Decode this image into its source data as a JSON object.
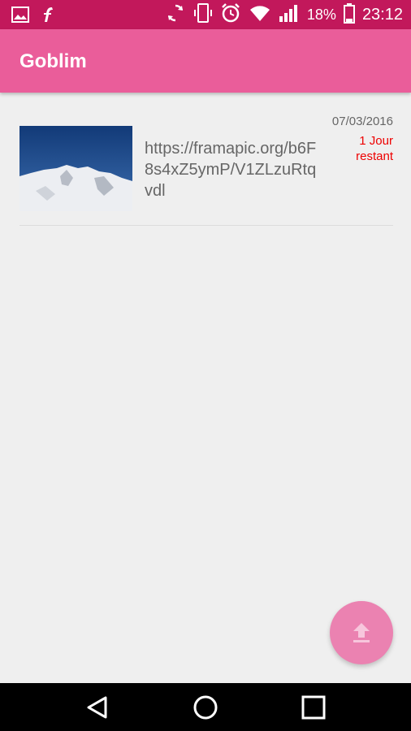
{
  "status_bar": {
    "battery_percent": "18%",
    "time": "23:12",
    "left_icons": [
      "image-icon",
      "flash-icon"
    ],
    "right_icons": [
      "sync-icon",
      "vibrate-icon",
      "alarm-icon",
      "wifi-icon",
      "signal-icon",
      "battery-icon"
    ]
  },
  "app_bar": {
    "title": "Goblim"
  },
  "uploads": [
    {
      "url": "https://framapic.org/b6F8s4xZ5ymP/V1ZLzuRtqvdl",
      "date": "07/03/2016",
      "remaining": "1 Jour restant"
    }
  ],
  "fab": {
    "icon": "upload-icon"
  },
  "nav_bar": {
    "buttons": [
      "back-icon",
      "home-icon",
      "recents-icon"
    ]
  },
  "colors": {
    "status_bar": "#c2185b",
    "app_bar": "#ea5d9a",
    "fab": "#eb82b1",
    "remaining_text": "#e00000",
    "background": "#efefef"
  }
}
